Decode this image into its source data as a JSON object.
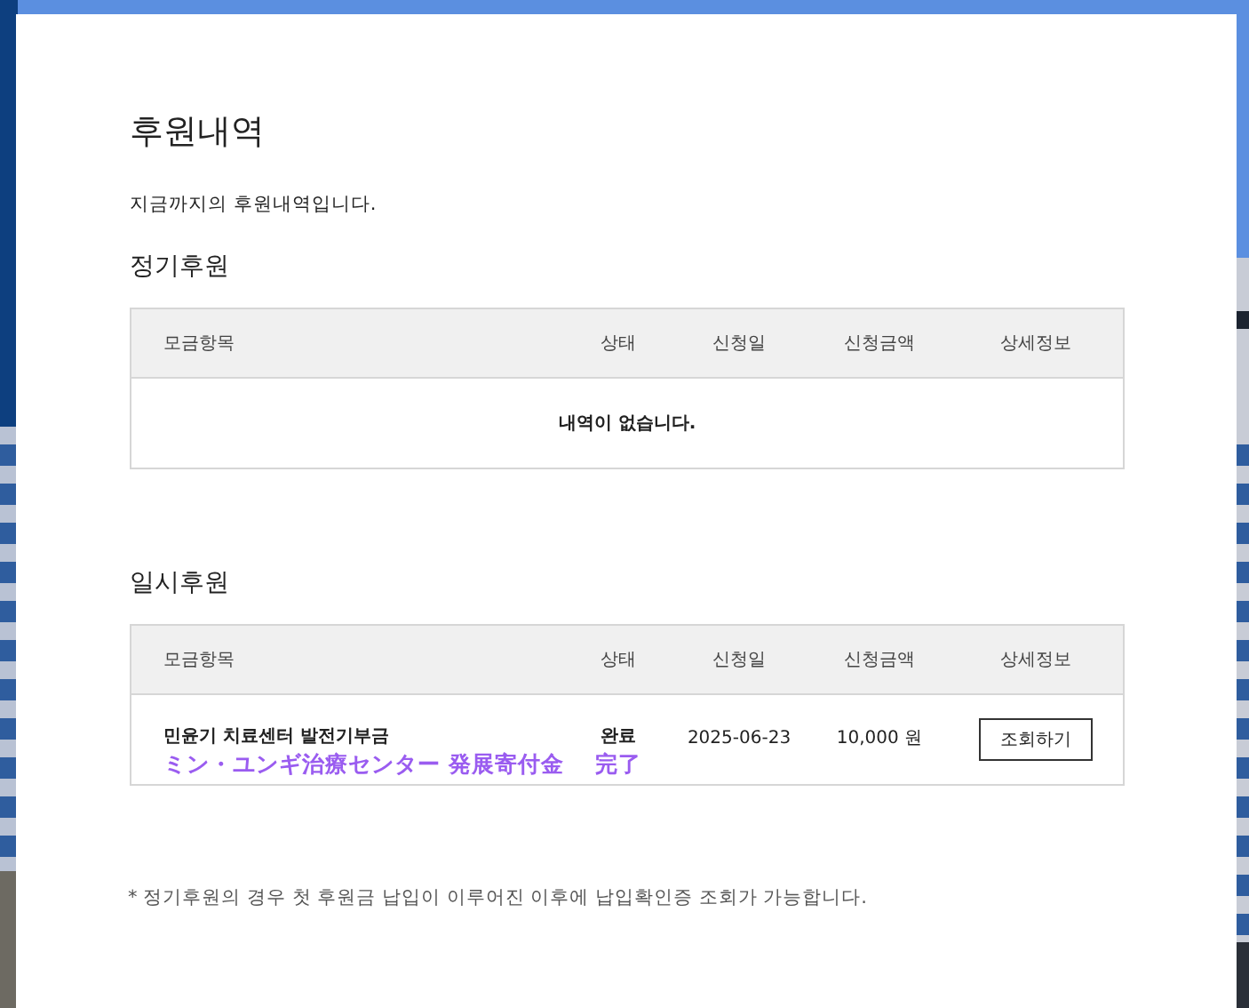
{
  "page": {
    "title": "후원내역",
    "description": "지금까지의 후원내역입니다."
  },
  "sections": [
    {
      "title": "정기후원",
      "columns": [
        "모금항목",
        "상태",
        "신청일",
        "신청금액",
        "상세정보"
      ],
      "empty_message": "내역이 없습니다."
    },
    {
      "title": "일시후원",
      "columns": [
        "모금항목",
        "상태",
        "신청일",
        "신청금액",
        "상세정보"
      ],
      "rows": [
        {
          "item": "민윤기 치료센터 발전기부금",
          "item_translation": "ミン・ユンギ治療センター 発展寄付金",
          "status": "완료",
          "status_translation": "完了",
          "date": "2025-06-23",
          "amount": "10,000 원",
          "action": "조회하기"
        }
      ]
    }
  ],
  "footnote": "* 정기후원의 경우 첫 후원금 납입이 이루어진 이후에 납입확인증 조회가 가능합니다."
}
